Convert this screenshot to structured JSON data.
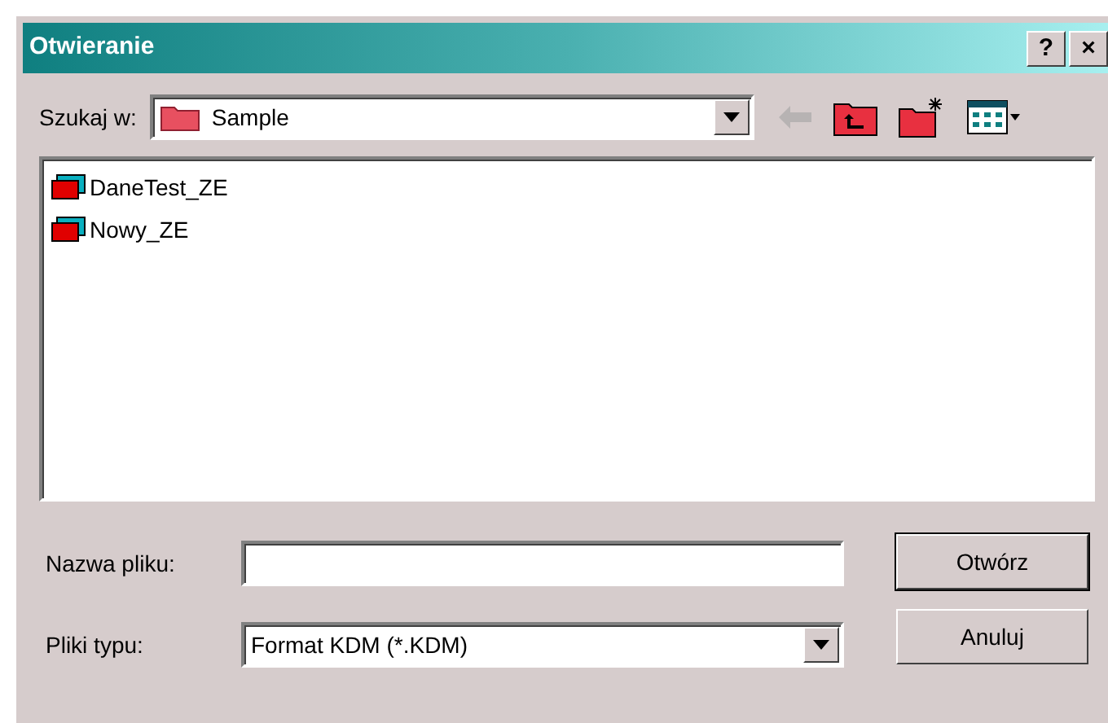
{
  "window": {
    "title": "Otwieranie",
    "help_button": "?",
    "close_button": "×"
  },
  "look_in": {
    "label": "Szukaj w:",
    "value": "Sample"
  },
  "toolbar": [
    {
      "kind": "back",
      "disabled": true
    },
    {
      "kind": "up",
      "disabled": false
    },
    {
      "kind": "newfolder",
      "disabled": false
    },
    {
      "kind": "view",
      "disabled": false
    }
  ],
  "files": [
    {
      "name": "DaneTest_ZE",
      "selected": false
    },
    {
      "name": "Nowy_ZE",
      "selected": false
    }
  ],
  "file_name": {
    "label": "Nazwa pliku:"
  },
  "file_type": {
    "label": "Pliki typu:",
    "value": "Format KDM (*.KDM)"
  },
  "buttons": [
    {
      "label": "Otwórz",
      "default": true
    },
    {
      "label": "Anuluj",
      "default": false
    }
  ]
}
